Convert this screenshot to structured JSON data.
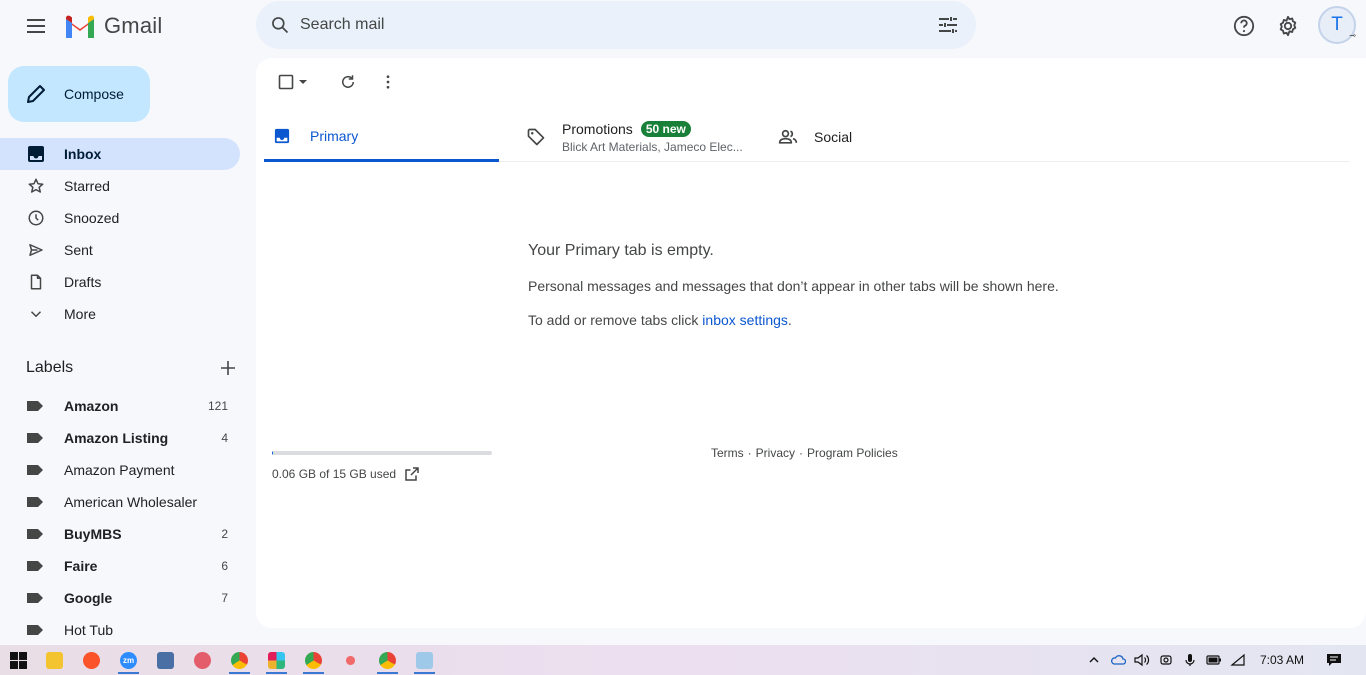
{
  "app": {
    "name": "Gmail"
  },
  "search": {
    "placeholder": "Search mail"
  },
  "account": {
    "initial": "T"
  },
  "compose": {
    "label": "Compose"
  },
  "nav": [
    {
      "label": "Inbox",
      "icon": "inbox-icon",
      "active": true
    },
    {
      "label": "Starred",
      "icon": "star-icon"
    },
    {
      "label": "Snoozed",
      "icon": "clock-icon"
    },
    {
      "label": "Sent",
      "icon": "send-icon"
    },
    {
      "label": "Drafts",
      "icon": "draft-icon"
    },
    {
      "label": "More",
      "icon": "chevron-down-icon"
    }
  ],
  "labels": {
    "title": "Labels",
    "items": [
      {
        "name": "Amazon",
        "count": "121",
        "bold": true
      },
      {
        "name": "Amazon Listing",
        "count": "4",
        "bold": true
      },
      {
        "name": "Amazon Payment",
        "count": "",
        "bold": false
      },
      {
        "name": "American Wholesaler",
        "count": "",
        "bold": false
      },
      {
        "name": "BuyMBS",
        "count": "2",
        "bold": true
      },
      {
        "name": "Faire",
        "count": "6",
        "bold": true
      },
      {
        "name": "Google",
        "count": "7",
        "bold": true
      },
      {
        "name": "Hot Tub",
        "count": "",
        "bold": false
      }
    ]
  },
  "tabs": {
    "primary": {
      "label": "Primary"
    },
    "promotions": {
      "label": "Promotions",
      "badge": "50 new",
      "snippet": "Blick Art Materials, Jameco Elec..."
    },
    "social": {
      "label": "Social"
    }
  },
  "empty_state": {
    "title": "Your Primary tab is empty.",
    "description": "Personal messages and messages that don’t appear in other tabs will be shown here.",
    "hint_prefix": "To add or remove tabs click ",
    "hint_link": "inbox settings",
    "hint_suffix": "."
  },
  "storage": {
    "text": "0.06 GB of 15 GB used",
    "fraction_used": 0.004
  },
  "footer": {
    "terms": "Terms",
    "privacy": "Privacy",
    "policies": "Program Policies",
    "separator": "·"
  },
  "taskbar": {
    "clock": "7:03 AM"
  },
  "colors": {
    "accent": "#0b57d0",
    "compose": "#c2e7ff",
    "active_nav": "#d3e3fd",
    "badge": "#188038"
  }
}
